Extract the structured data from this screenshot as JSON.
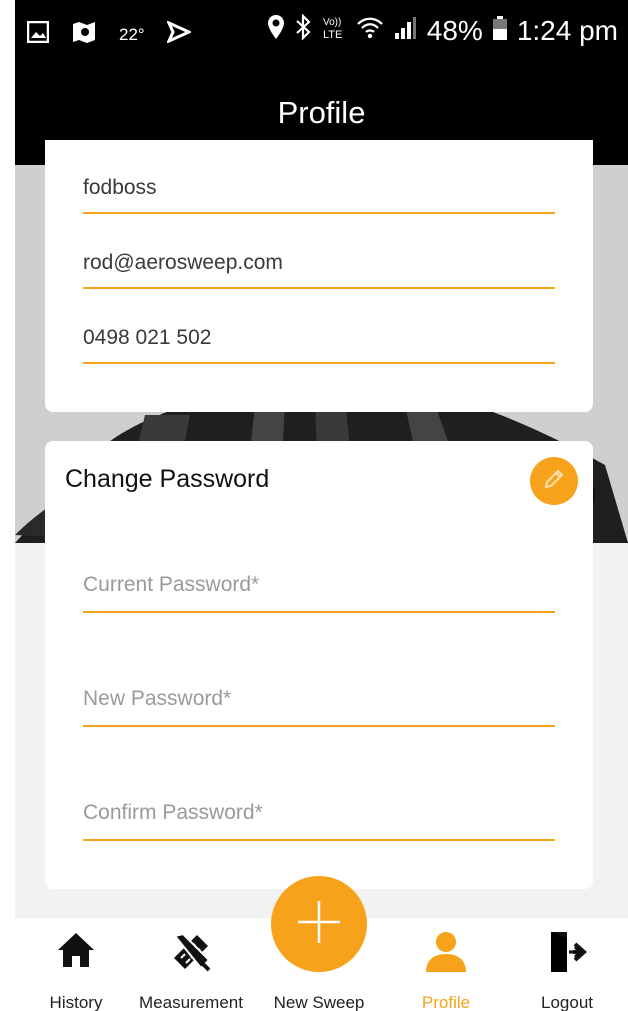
{
  "status_bar": {
    "temperature": "22°",
    "battery": "48%",
    "time": "1:24 pm"
  },
  "app_bar": {
    "title": "Profile"
  },
  "profile_card": {
    "username": "fodboss",
    "email": "rod@aerosweep.com",
    "phone": "0498 021 502"
  },
  "password_card": {
    "title": "Change Password",
    "current_placeholder": "Current Password*",
    "new_placeholder": "New Password*",
    "confirm_placeholder": "Confirm Password*"
  },
  "bottom_nav": {
    "history": "History",
    "measurement": "Measurement",
    "new_sweep": "New Sweep",
    "profile": "Profile",
    "logout": "Logout",
    "active": "Profile"
  },
  "colors": {
    "accent": "#f7a21b",
    "bar": "#000000"
  },
  "icons": [
    "home-icon",
    "ruler-pencil-icon",
    "plus-icon",
    "person-icon",
    "logout-icon",
    "pencil-icon"
  ]
}
